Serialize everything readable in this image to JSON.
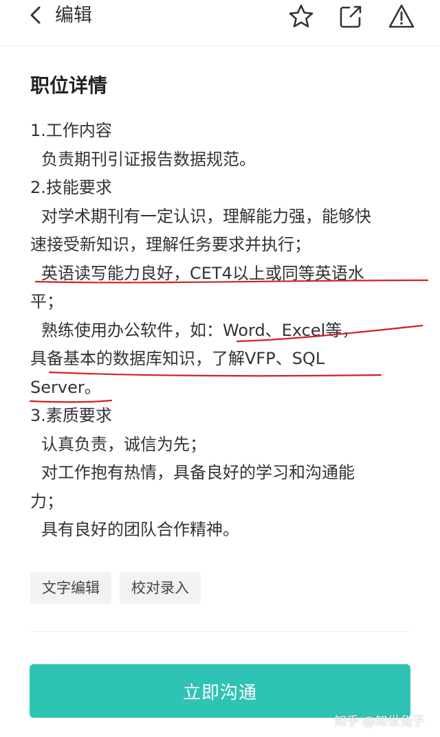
{
  "header": {
    "back_label": "编辑",
    "icons": [
      "back-arrow-icon",
      "star-icon",
      "share-icon",
      "warning-icon"
    ]
  },
  "section": {
    "title": "职位详情"
  },
  "description_lines": [
    "1.工作内容",
    "负责期刊引证报告数据规范。",
    "2.技能要求",
    "对学术期刊有一定认识，理解能力强，能够快",
    "速接受新知识，理解任务要求并执行；",
    "英语读写能力良好，CET4以上或同等英语水",
    "平；",
    "熟练使用办公软件，如：Word、Excel等，",
    "具备基本的数据库知识，了解VFP、SQL",
    "Server。",
    "3.素质要求",
    "认真负责，诚信为先；",
    "对工作抱有热情，具备良好的学习和沟通能",
    "力；",
    "具有良好的团队合作精神。"
  ],
  "tags": [
    "文字编辑",
    "校对录入"
  ],
  "cta_label": "立即沟通",
  "watermark": "知乎 @知世兔子",
  "colors": {
    "accent": "#2fc3b4",
    "underline": "#d22020"
  }
}
